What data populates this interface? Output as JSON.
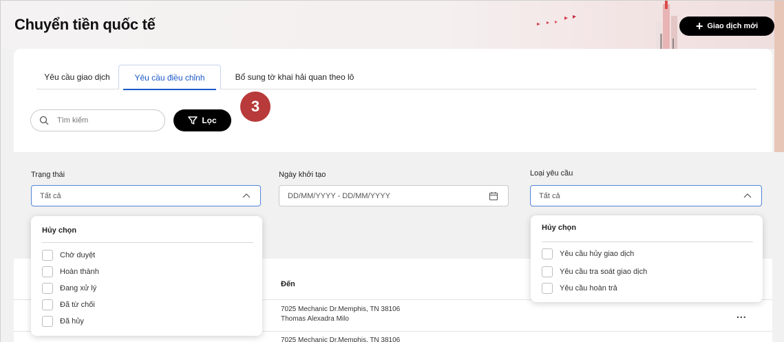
{
  "header": {
    "title": "Chuyển tiền quốc tế",
    "new_transaction_label": "Giao dịch mới"
  },
  "tabs": [
    {
      "label": "Yêu cầu giao dịch",
      "active": false
    },
    {
      "label": "Yêu cầu điều chỉnh",
      "active": true
    },
    {
      "label": "Bổ sung tờ khai hải quan theo lô",
      "active": false
    }
  ],
  "search": {
    "placeholder": "Tìm kiếm"
  },
  "filter_button_label": "Lọc",
  "step_badge": "3",
  "filters": {
    "status": {
      "label": "Trạng thái",
      "value": "Tất cả"
    },
    "created_date": {
      "label": "Ngày khởi tạo",
      "placeholder": "DD/MM/YYYY - DD/MM/YYYY"
    },
    "request_type": {
      "label": "Loại yêu cầu",
      "value": "Tất cả"
    }
  },
  "status_dropdown": {
    "clear_label": "Hủy chọn",
    "options": [
      "Chờ duyệt",
      "Hoàn thành",
      "Đang xử lý",
      "Đã từ chối",
      "Đã hủy"
    ]
  },
  "type_dropdown": {
    "clear_label": "Hủy chọn",
    "options": [
      "Yêu cầu hủy giao dịch",
      "Yêu cầu tra soát giao dịch",
      "Yêu cầu hoàn trả"
    ]
  },
  "table": {
    "columns": {
      "to": "Đến"
    },
    "rows": [
      {
        "address": "7025 Mechanic Dr.Memphis, TN 38106",
        "name": "Thomas Alexadra Milo",
        "more": "..."
      },
      {
        "address": "7025 Mechanic Dr.Memphis, TN 38106",
        "name": "",
        "more": ""
      }
    ]
  },
  "colors": {
    "accent": "#1b59c7",
    "badge": "#b83a3a",
    "primary_button": "#000000"
  }
}
